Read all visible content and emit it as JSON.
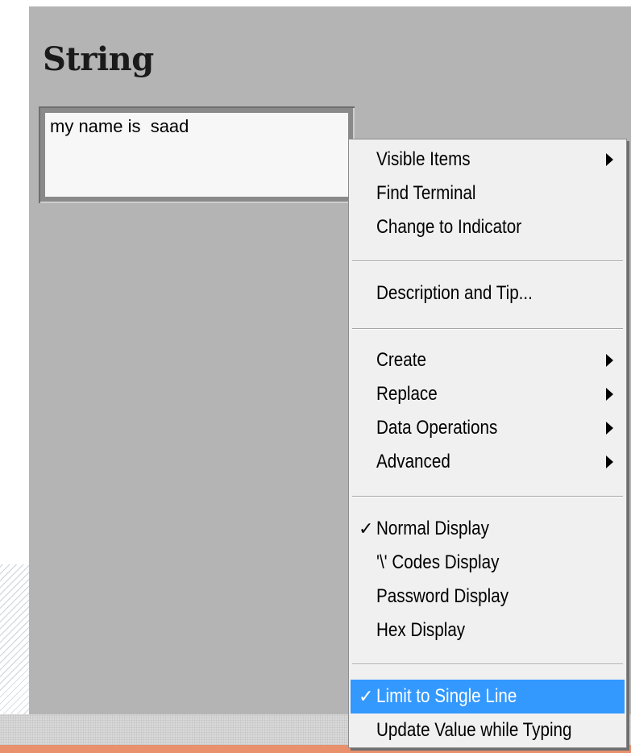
{
  "control": {
    "label": "String",
    "value": "my name is  saad"
  },
  "menu": {
    "groups": [
      [
        {
          "label": "Visible Items",
          "submenu": true
        },
        {
          "label": "Find Terminal"
        },
        {
          "label": "Change to Indicator"
        }
      ],
      [
        {
          "label": "Description and Tip..."
        }
      ],
      [
        {
          "label": "Create",
          "submenu": true
        },
        {
          "label": "Replace",
          "submenu": true
        },
        {
          "label": "Data Operations",
          "submenu": true
        },
        {
          "label": "Advanced",
          "submenu": true
        }
      ],
      [
        {
          "label": "Normal Display",
          "checked": true
        },
        {
          "label": "'\\' Codes Display"
        },
        {
          "label": "Password Display"
        },
        {
          "label": "Hex Display"
        }
      ],
      [
        {
          "label": "Limit to Single Line",
          "checked": true,
          "highlighted": true
        },
        {
          "label": "Update Value while Typing"
        }
      ]
    ]
  },
  "icons": {
    "check": "check-icon",
    "submenu_arrow": "submenu-arrow-icon"
  },
  "colors": {
    "panel": "#b4b4b4",
    "menu_background": "#f0f0f0",
    "highlight": "#3399ff",
    "accent_bar": "#e8916c"
  }
}
